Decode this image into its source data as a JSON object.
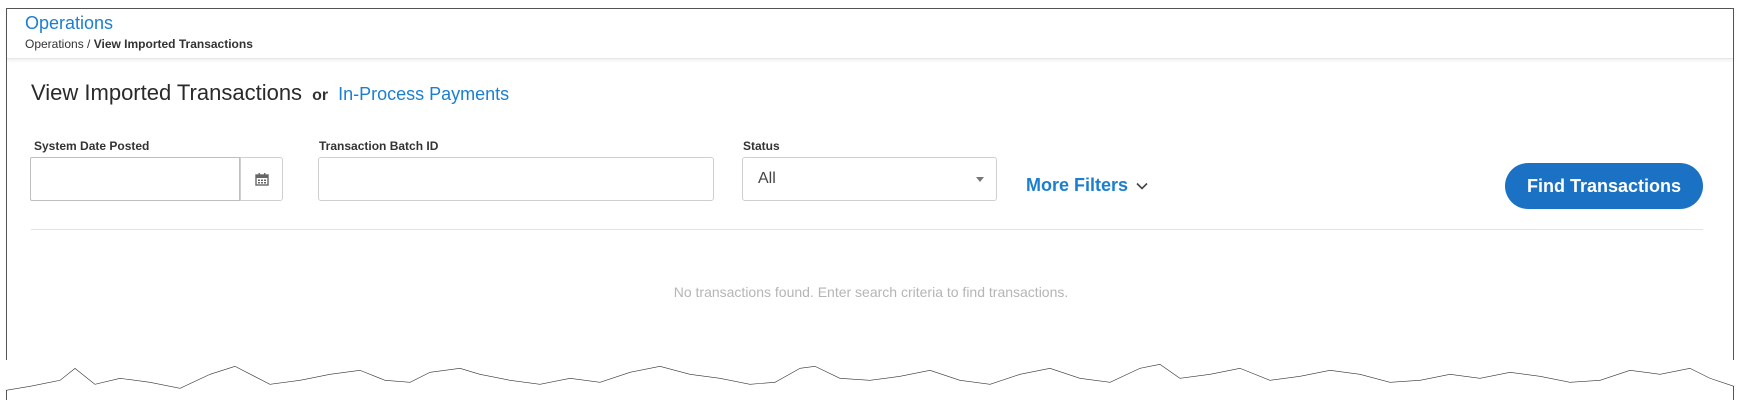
{
  "header": {
    "app_title": "Operations",
    "breadcrumb": {
      "parent": "Operations",
      "separator": " / ",
      "current": "View Imported Transactions"
    }
  },
  "page": {
    "title": "View Imported Transactions",
    "or_text": "or",
    "alt_link": "In-Process Payments"
  },
  "filters": {
    "date_posted": {
      "label": "System Date Posted",
      "value": "",
      "icon": "calendar-icon"
    },
    "batch_id": {
      "label": "Transaction Batch ID",
      "value": ""
    },
    "status": {
      "label": "Status",
      "selected": "All"
    },
    "more_filters": "More Filters"
  },
  "actions": {
    "find_label": "Find Transactions"
  },
  "results": {
    "empty_message": "No transactions found. Enter search criteria to find transactions."
  },
  "colors": {
    "link": "#1b7fd0",
    "primary_button": "#1b72c4",
    "muted_text": "#b5b5b5"
  }
}
